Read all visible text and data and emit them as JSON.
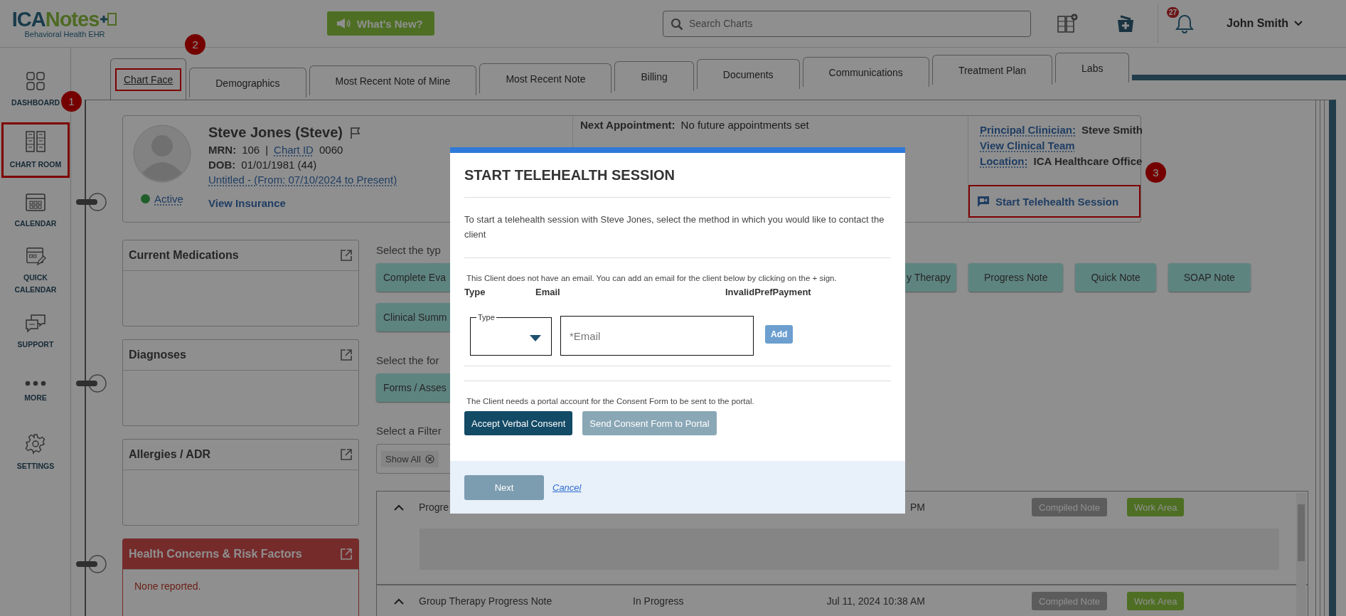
{
  "header": {
    "logo": {
      "brand_first": "ICA",
      "brand_second": "Notes",
      "tagline": "Behavioral Health EHR"
    },
    "whats_new": "What's New?",
    "search": {
      "placeholder": "Search Charts"
    },
    "notification_count": "27",
    "user": "John Smith"
  },
  "sidebar": {
    "items": [
      {
        "label": "DASHBOARD",
        "highlighted": false
      },
      {
        "label": "CHART ROOM",
        "highlighted": true,
        "callout": "1"
      },
      {
        "label": "CALENDAR",
        "highlighted": false
      },
      {
        "label": "QUICK CALENDAR",
        "highlighted": false
      },
      {
        "label": "SUPPORT",
        "highlighted": false
      },
      {
        "label": "MORE",
        "highlighted": false
      },
      {
        "label": "SETTINGS",
        "highlighted": false
      }
    ]
  },
  "tabs": [
    {
      "label": "Chart Face",
      "selected": true,
      "highlighted": true,
      "callout": "2"
    },
    {
      "label": "Demographics",
      "selected": false,
      "highlighted": false
    },
    {
      "label": "Most Recent Note of Mine",
      "selected": false,
      "highlighted": false
    },
    {
      "label": "Most Recent Note",
      "selected": false,
      "highlighted": false
    },
    {
      "label": "Billing",
      "selected": false,
      "highlighted": false
    },
    {
      "label": "Documents",
      "selected": false,
      "highlighted": false
    },
    {
      "label": "Communications",
      "selected": false,
      "highlighted": false
    },
    {
      "label": "Treatment Plan",
      "selected": false,
      "highlighted": false
    },
    {
      "label": "Labs",
      "selected": false,
      "highlighted": false
    }
  ],
  "patient": {
    "name": "Steve Jones (Steve)",
    "mrn_label": "MRN:",
    "mrn": "106",
    "separator": "|",
    "chart_id_label": "Chart ID",
    "chart_id": "0060",
    "dob_label": "DOB:",
    "dob": "01/01/1981 (44)",
    "episode": "Untitled - (From: 07/10/2024 to Present)",
    "status": {
      "label": "Active"
    },
    "insurance_link": "View Insurance",
    "next_appointment_label": "Next Appointment:",
    "next_appointment": "No future appointments set",
    "clinician_label": "Principal Clinician:",
    "clinician": "Steve Smith",
    "team_link": "View Clinical Team",
    "location_label": "Location:",
    "location": "ICA Healthcare Office",
    "telehealth": {
      "label": "Start Telehealth Session",
      "highlighted": true,
      "callout": "3"
    }
  },
  "widgets": [
    {
      "title": "Current Medications",
      "kind": "normal"
    },
    {
      "title": "Diagnoses",
      "kind": "normal"
    },
    {
      "title": "Allergies / ADR",
      "kind": "normal"
    },
    {
      "title": "Health Concerns & Risk Factors",
      "kind": "alert",
      "body": "None reported."
    }
  ],
  "notes_panel": {
    "type_prompt": "Select the typ",
    "type_rows": [
      {
        "left": "Complete Eva",
        "right": [
          "y Therapy",
          "Progress Note",
          "Quick Note",
          "SOAP Note"
        ]
      },
      {
        "left": "Clinical Summ",
        "right": []
      }
    ],
    "form_prompt": "Select the for",
    "form_left": "Forms / Asses",
    "filter_prompt": "Select a Filter",
    "filter_chip": "Show All"
  },
  "table": {
    "rows": [
      {
        "expanded": true,
        "name": "Progre",
        "time": "PM",
        "badges": [
          {
            "label": "Compiled Note",
            "kind": "compiled"
          },
          {
            "label": "Work Area",
            "kind": "workarea"
          }
        ]
      },
      {
        "expanded": false,
        "name": "Group Therapy Progress Note",
        "status": "In Progress",
        "time": "Jul 11, 2024 10:38 AM",
        "badges": [
          {
            "label": "Compiled Note",
            "kind": "compiled"
          },
          {
            "label": "Work Area",
            "kind": "workarea"
          }
        ]
      }
    ]
  },
  "modal": {
    "title": "START TELEHEALTH SESSION",
    "intro": "To start a telehealth session with Steve Jones, select the method in which you would like to contact the client",
    "email_note": "This Client does not have an email. You can add an email for the client below by clicking on the + sign.",
    "columns": [
      "Type",
      "Email",
      "InvalidPrefPayment"
    ],
    "type_select": {
      "label": "Type"
    },
    "email_field": {
      "placeholder": "*Email"
    },
    "add_button": "Add",
    "consent_note": "The Client needs a portal account for the Consent Form to be sent to the portal.",
    "consent_buttons": [
      {
        "label": "Accept Verbal Consent",
        "disabled": false
      },
      {
        "label": "Send Consent Form to Portal",
        "disabled": true
      }
    ],
    "next": {
      "label": "Next",
      "disabled": true
    },
    "cancel": "Cancel"
  }
}
